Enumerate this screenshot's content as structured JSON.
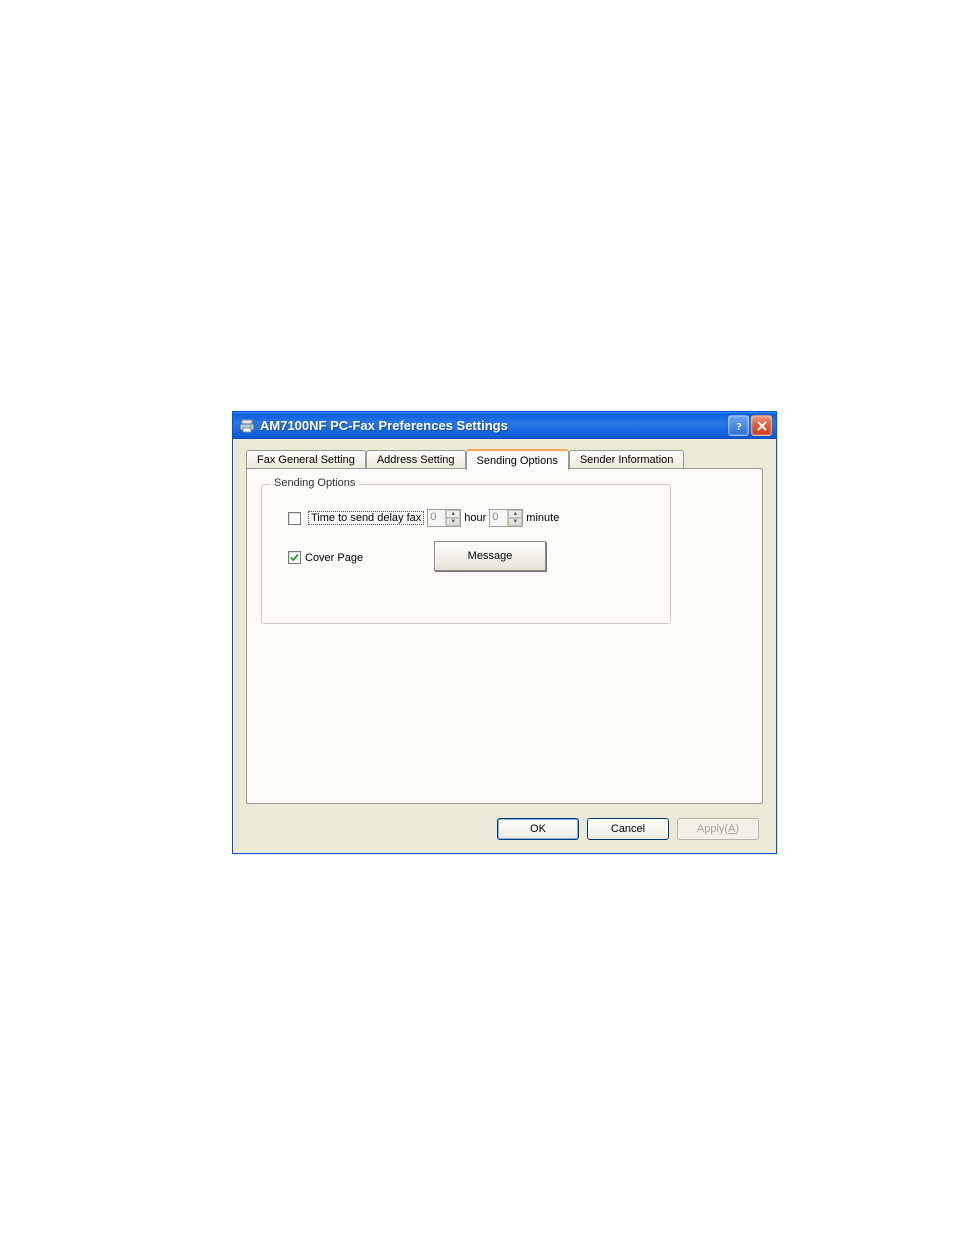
{
  "window": {
    "title": "AM7100NF PC-Fax Preferences Settings",
    "icon": "printer-icon"
  },
  "tabs": {
    "items": [
      {
        "label": "Fax General Setting"
      },
      {
        "label": "Address Setting"
      },
      {
        "label": "Sending Options"
      },
      {
        "label": "Sender Information"
      }
    ],
    "activeIndex": 2
  },
  "group": {
    "legend": "Sending Options",
    "delay": {
      "checked": false,
      "label": "Time to send delay fax",
      "hour_value": "0",
      "hour_label": "hour",
      "minute_value": "0",
      "minute_label": "minute"
    },
    "cover": {
      "checked": true,
      "label": "Cover Page",
      "button": "Message"
    }
  },
  "buttons": {
    "ok": "OK",
    "cancel": "Cancel",
    "apply_prefix": "Apply(",
    "apply_key": "A",
    "apply_suffix": ")",
    "apply_enabled": false
  }
}
